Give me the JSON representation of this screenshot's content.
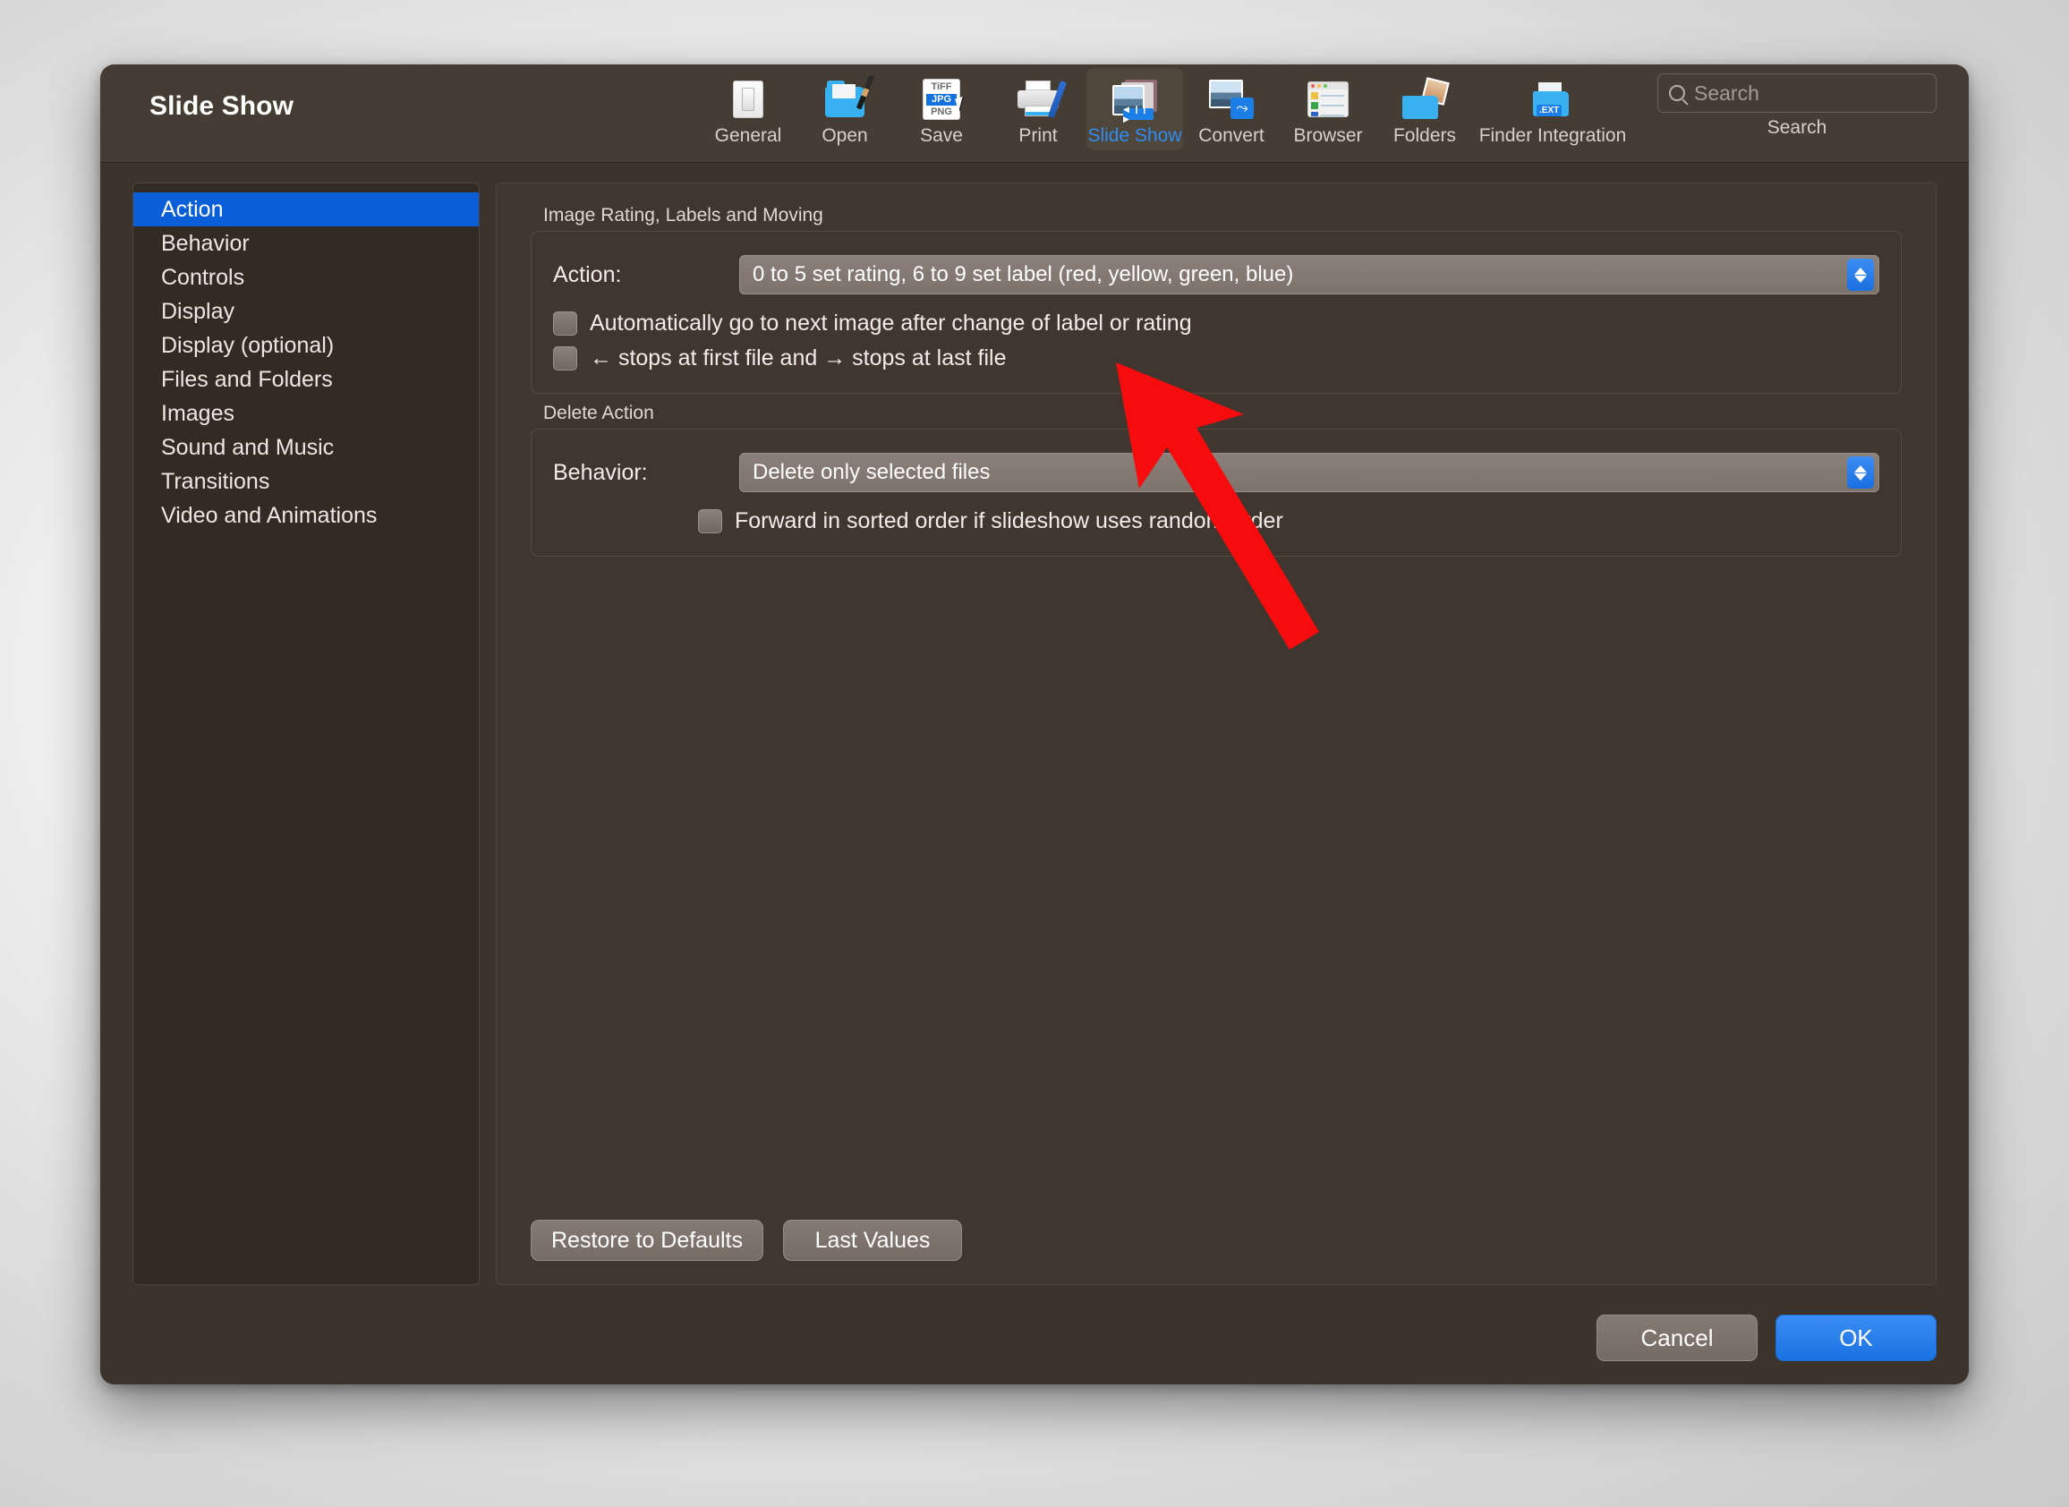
{
  "window": {
    "title": "Slide Show"
  },
  "toolbar": {
    "items": [
      {
        "label": "General",
        "icon": "light-switch-icon",
        "selected": false
      },
      {
        "label": "Open",
        "icon": "folder-brush-icon",
        "selected": false
      },
      {
        "label": "Save",
        "icon": "file-formats-icon",
        "selected": false
      },
      {
        "label": "Print",
        "icon": "printer-icon",
        "selected": false
      },
      {
        "label": "Slide Show",
        "icon": "slideshow-icon",
        "selected": true
      },
      {
        "label": "Convert",
        "icon": "convert-image-icon",
        "selected": false
      },
      {
        "label": "Browser",
        "icon": "browser-window-icon",
        "selected": false
      },
      {
        "label": "Folders",
        "icon": "folders-photo-icon",
        "selected": false
      },
      {
        "label": "Finder Integration",
        "icon": "finder-extension-icon",
        "selected": false
      }
    ],
    "formats_icon_text": {
      "line1": "TiFF",
      "line2": "JPG",
      "line3": "PNG"
    },
    "slideshow_controls_glyph": "◀ ❙❙ ▶"
  },
  "search": {
    "placeholder": "Search",
    "value": "",
    "caption": "Search",
    "icon": "search-icon"
  },
  "sidebar": {
    "items": [
      {
        "label": "Action",
        "active": true
      },
      {
        "label": "Behavior",
        "active": false
      },
      {
        "label": "Controls",
        "active": false
      },
      {
        "label": "Display",
        "active": false
      },
      {
        "label": "Display (optional)",
        "active": false
      },
      {
        "label": "Files and Folders",
        "active": false
      },
      {
        "label": "Images",
        "active": false
      },
      {
        "label": "Sound and Music",
        "active": false
      },
      {
        "label": "Transitions",
        "active": false
      },
      {
        "label": "Video and Animations",
        "active": false
      }
    ]
  },
  "main": {
    "groups": [
      {
        "title": "Image Rating, Labels and Moving",
        "field_label": "Action:",
        "field_value": "0 to 5 set rating, 6 to 9 set label (red, yellow, green, blue)",
        "checkboxes": [
          {
            "label": "Automatically go to next image after change of label or rating",
            "checked": false
          },
          {
            "label": "← stops at first file and → stops at last file",
            "checked": false
          }
        ]
      },
      {
        "title": "Delete Action",
        "field_label": "Behavior:",
        "field_value": "Delete only selected files",
        "checkboxes": [
          {
            "label": "Forward in sorted order if slideshow uses random order",
            "checked": false
          }
        ]
      }
    ],
    "pane_buttons": [
      {
        "label": "Restore to Defaults"
      },
      {
        "label": "Last Values"
      }
    ]
  },
  "footer": {
    "cancel_label": "Cancel",
    "ok_label": "OK"
  },
  "colors": {
    "window_bg": "#3c342c",
    "toolbar_bg": "#453c33",
    "pane_bg": "#3f372f",
    "sidebar_bg": "#322b24",
    "accent_blue": "#0a5fd8",
    "selected_tab_text": "#2f8cf0",
    "annotation_red": "#f60c0c"
  },
  "annotation": {
    "type": "arrow",
    "color": "#f60c0c",
    "points_to": "Automatically go to next image after change of label or rating"
  }
}
